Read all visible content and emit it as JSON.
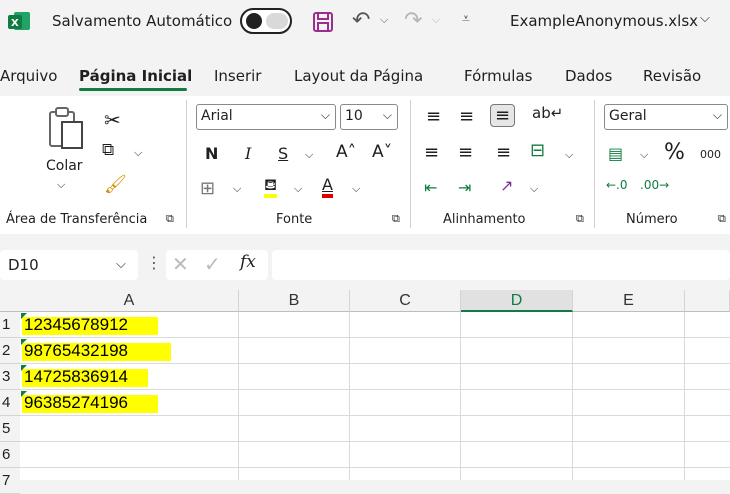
{
  "titlebar": {
    "autosave_label": "Salvamento Automático",
    "filename": "ExampleAnonymous.xlsx",
    "filename_chevron": "⌵"
  },
  "menu": [
    "Arquivo",
    "Página Inicial",
    "Inserir",
    "Layout da Página",
    "Fórmulas",
    "Dados",
    "Revisão"
  ],
  "ribbon": {
    "clipboard": {
      "paste_label": "Colar",
      "group_label": "Área de Transferência"
    },
    "font": {
      "font_name": "Arial",
      "font_size": "10",
      "bold": "N",
      "italic": "I",
      "underline": "S",
      "grow": "A˄",
      "shrink": "A˅",
      "font_color_glyph": "A",
      "group_label": "Fonte"
    },
    "alignment": {
      "group_label": "Alinhamento"
    },
    "number": {
      "format": "Geral",
      "percent": "%",
      "thousands": "000",
      "group_label": "Número"
    }
  },
  "formula_bar": {
    "name_box": "D10",
    "fx": "fx",
    "formula": ""
  },
  "grid": {
    "columns": [
      "A",
      "B",
      "C",
      "D",
      "E"
    ],
    "rows": [
      "1",
      "2",
      "3",
      "4",
      "5",
      "6",
      "7"
    ],
    "cells": [
      "12345678912",
      "98765432198",
      "14725836914",
      "96385274196"
    ],
    "highlight_color": "#ffff00",
    "selected_column": "D"
  }
}
